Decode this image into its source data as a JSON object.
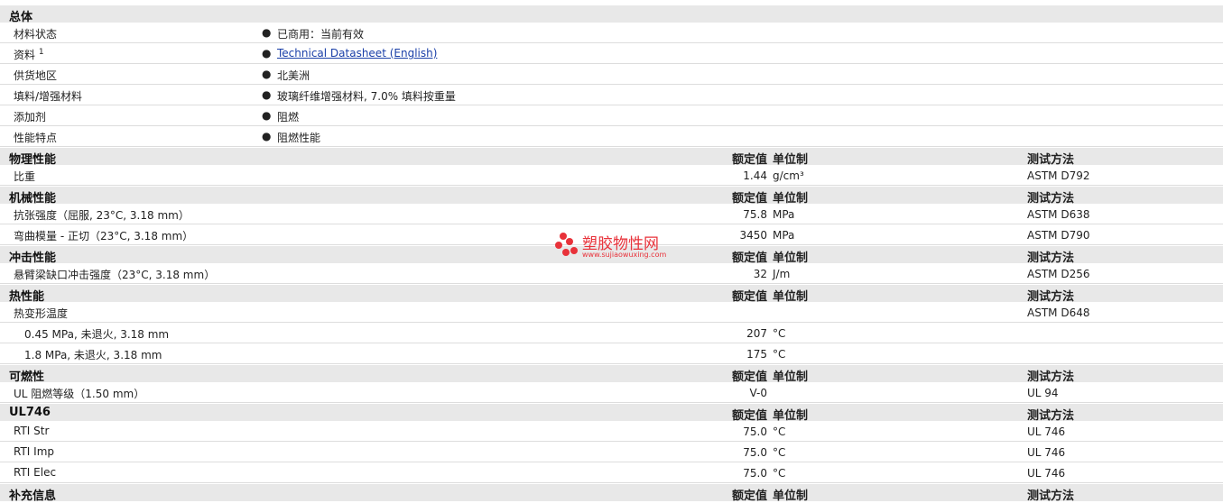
{
  "general": {
    "title": "总体",
    "rows": [
      {
        "label": "材料状态",
        "value": "已商用：当前有效"
      },
      {
        "label": "资料",
        "sup": "1",
        "value": "Technical Datasheet (English)"
      },
      {
        "label": "供货地区",
        "value": "北美洲"
      },
      {
        "label": "填料/增强材料",
        "value": "玻璃纤维增强材料, 7.0% 填料按重量"
      },
      {
        "label": "添加剂",
        "value": "阻燃"
      },
      {
        "label": "性能特点",
        "value": "阻燃性能"
      }
    ]
  },
  "col_headers": {
    "value": "额定值",
    "unit": "单位制",
    "method": "测试方法"
  },
  "sections": [
    {
      "title": "物理性能",
      "rows": [
        {
          "label": "比重",
          "value": "1.44",
          "unit": "g/cm³",
          "method": "ASTM D792"
        }
      ]
    },
    {
      "title": "机械性能",
      "rows": [
        {
          "label": "抗张强度（屈服, 23°C, 3.18 mm）",
          "value": "75.8",
          "unit": "MPa",
          "method": "ASTM D638"
        },
        {
          "label": "弯曲模量 - 正切（23°C, 3.18 mm）",
          "value": "3450",
          "unit": "MPa",
          "method": "ASTM D790"
        }
      ]
    },
    {
      "title": "冲击性能",
      "rows": [
        {
          "label": "悬臂梁缺口冲击强度（23°C, 3.18 mm）",
          "value": "32",
          "unit": "J/m",
          "method": "ASTM D256"
        }
      ]
    },
    {
      "title": "热性能",
      "rows": [
        {
          "label": "热变形温度",
          "value": "",
          "unit": "",
          "method": "ASTM D648"
        },
        {
          "label": "0.45 MPa, 未退火, 3.18 mm",
          "indent": true,
          "value": "207",
          "unit": "°C",
          "method": ""
        },
        {
          "label": "1.8 MPa, 未退火, 3.18 mm",
          "indent": true,
          "value": "175",
          "unit": "°C",
          "method": ""
        }
      ]
    },
    {
      "title": "可燃性",
      "rows": [
        {
          "label": "UL 阻燃等级（1.50 mm）",
          "value": "V-0",
          "unit": "",
          "method": "UL 94"
        }
      ]
    },
    {
      "title": "UL746",
      "rows": [
        {
          "label": "RTI Str",
          "value": "75.0",
          "unit": "°C",
          "method": "UL 746"
        },
        {
          "label": "RTI Imp",
          "value": "75.0",
          "unit": "°C",
          "method": "UL 746"
        },
        {
          "label": "RTI Elec",
          "value": "75.0",
          "unit": "°C",
          "method": "UL 746"
        }
      ]
    },
    {
      "title": "补充信息",
      "rows": []
    }
  ],
  "watermark": {
    "name": "塑胶物性网",
    "url": "www.sujiaowuxing.com",
    "color": "#e8323a"
  }
}
